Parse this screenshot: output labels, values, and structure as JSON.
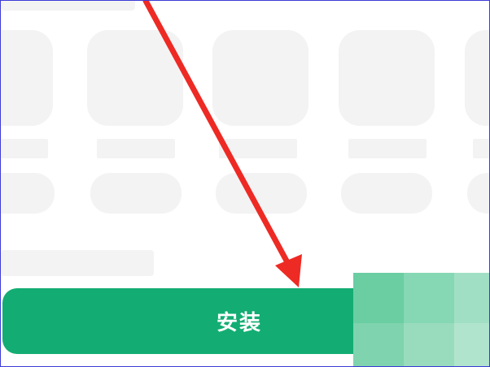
{
  "install_button": {
    "label": "安装"
  },
  "colors": {
    "button": "#13ad73",
    "placeholder": "#f3f3f4",
    "arrow": "#ee2a24",
    "mosaic": [
      "#6bcea3",
      "#86d7b4",
      "#a1dfc4",
      "#7fd3ae",
      "#99dcbd",
      "#b0e4cd"
    ]
  },
  "icons": {
    "arrow": "red-arrow-annotation"
  }
}
